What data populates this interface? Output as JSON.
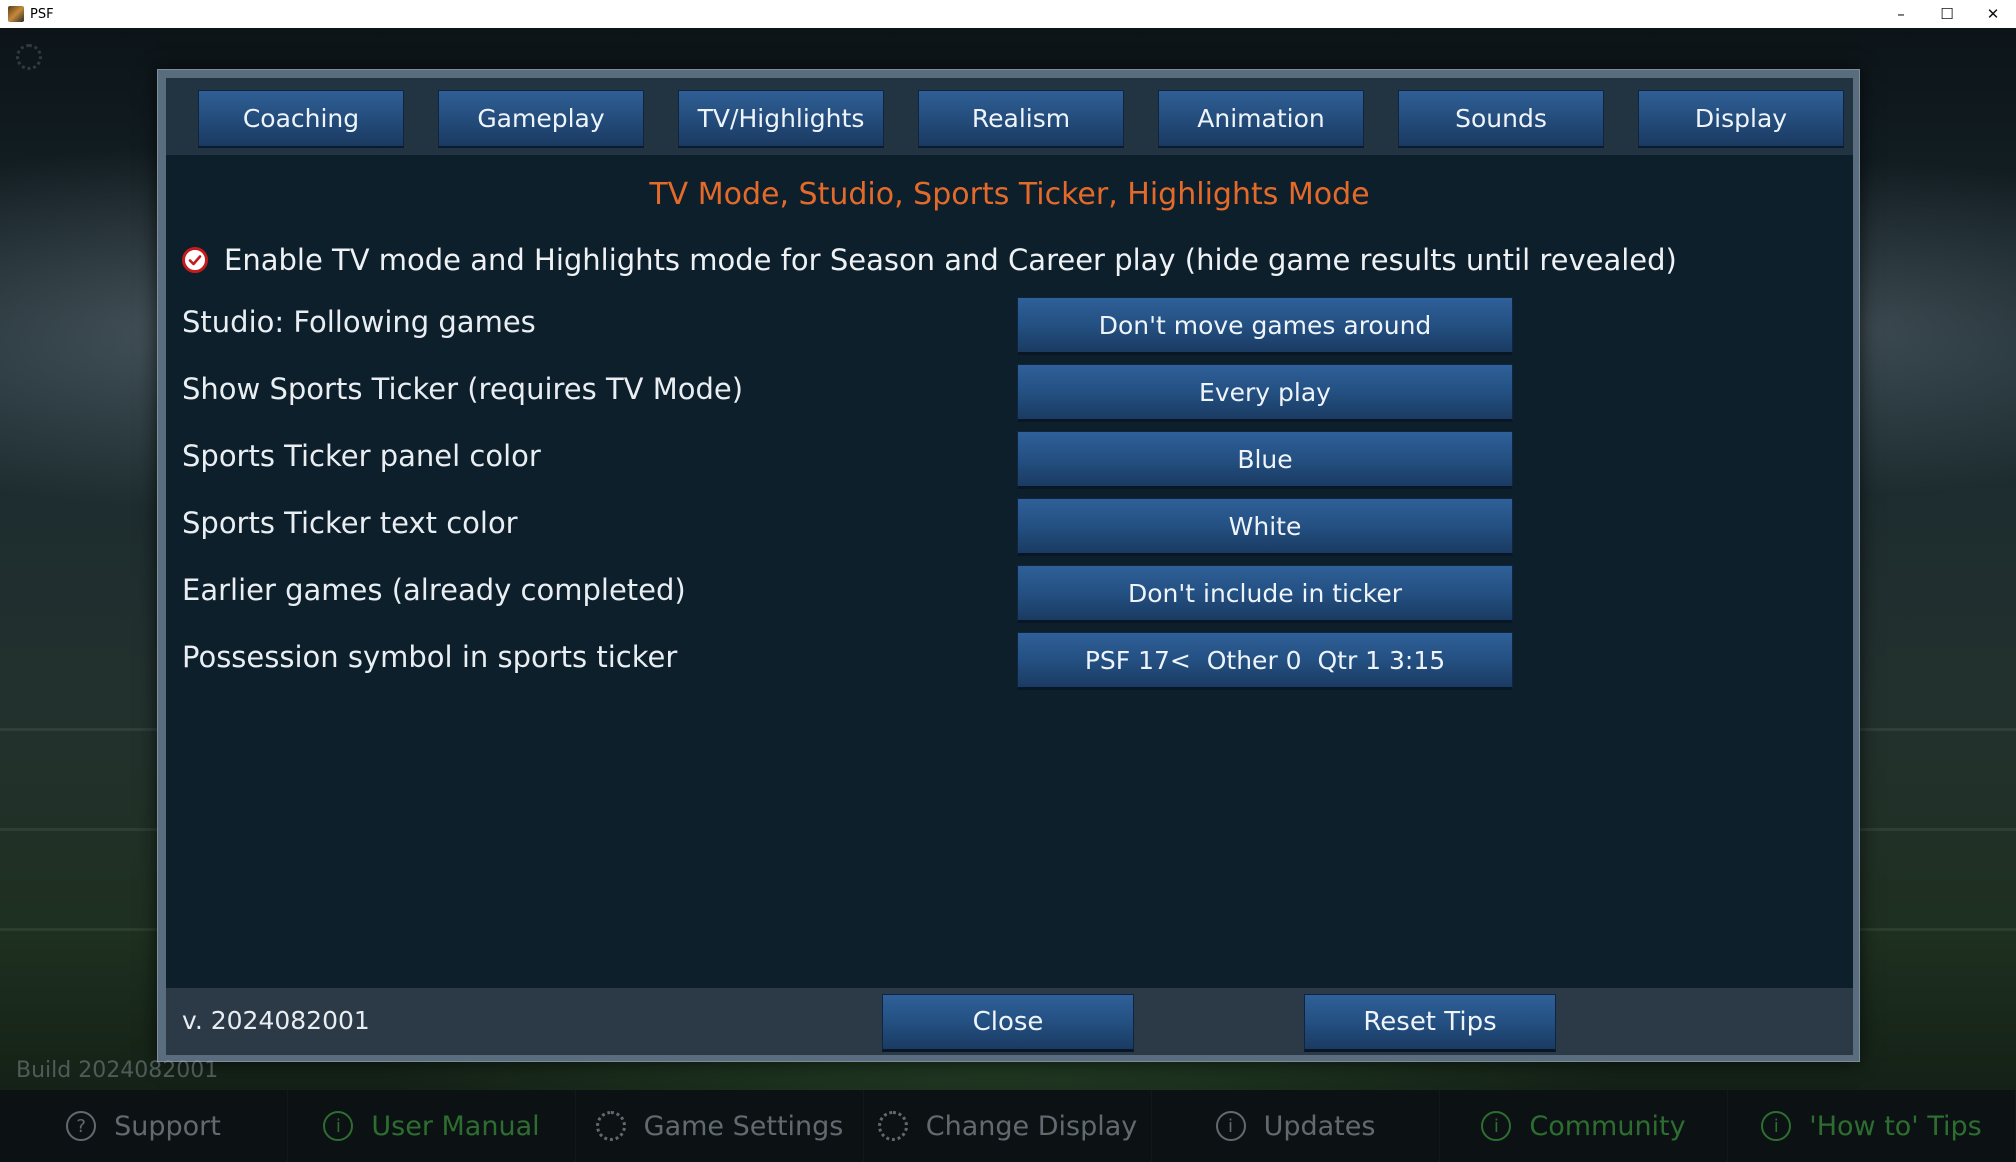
{
  "window": {
    "title": "PSF",
    "controls": {
      "minimize": "–",
      "maximize": "☐",
      "close": "✕"
    }
  },
  "tabs": [
    {
      "label": "Coaching"
    },
    {
      "label": "Gameplay"
    },
    {
      "label": "TV/Highlights"
    },
    {
      "label": "Realism"
    },
    {
      "label": "Animation"
    },
    {
      "label": "Sounds"
    },
    {
      "label": "Display"
    }
  ],
  "section_title": "TV Mode, Studio, Sports Ticker, Highlights Mode",
  "enable_option": {
    "label": "Enable TV mode and Highlights mode for Season and Career play (hide game results until revealed)",
    "checked": true,
    "icon": "red-check-circle-icon"
  },
  "options": [
    {
      "label": "Studio: Following games",
      "value": "Don't move games around"
    },
    {
      "label": "Show Sports Ticker (requires TV Mode)",
      "value": "Every play"
    },
    {
      "label": "Sports Ticker panel color",
      "value": "Blue"
    },
    {
      "label": "Sports Ticker text color",
      "value": "White"
    },
    {
      "label": "Earlier games (already completed)",
      "value": "Don't include in ticker"
    },
    {
      "label": "Possession symbol in sports ticker",
      "value": "PSF 17<  Other 0  Qtr 1 3:15"
    }
  ],
  "footer": {
    "version": "v. 2024082001",
    "close_label": "Close",
    "reset_label": "Reset Tips"
  },
  "build_label": "Build 2024082001",
  "bottom_nav": [
    {
      "label": "Support",
      "icon": "help-icon",
      "glyph": "?"
    },
    {
      "label": "User Manual",
      "icon": "info-icon",
      "glyph": "i"
    },
    {
      "label": "Game Settings",
      "icon": "gear-icon",
      "glyph": ""
    },
    {
      "label": "Change Display",
      "icon": "gear-icon",
      "glyph": ""
    },
    {
      "label": "Updates",
      "icon": "info-icon",
      "glyph": "i"
    },
    {
      "label": "Community",
      "icon": "info-icon",
      "glyph": "i"
    },
    {
      "label": "'How to' Tips",
      "icon": "info-icon",
      "glyph": "i"
    }
  ],
  "colors": {
    "accent_orange": "#e46a2a",
    "button_blue": "#245082",
    "check_red": "#c41c1c",
    "nav_green": "#3c963c"
  }
}
